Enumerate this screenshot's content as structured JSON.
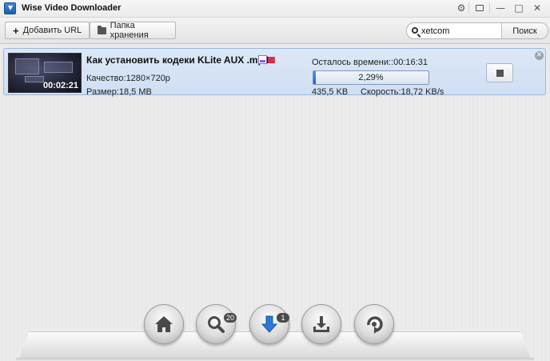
{
  "window": {
    "title": "Wise Video Downloader",
    "controls": {
      "settings_icon": "gear-icon",
      "menu_icon": "menu-icon",
      "minimize": "—",
      "maximize": "□",
      "close": "✕"
    }
  },
  "toolbar": {
    "add_url_label": "Добавить URL",
    "storage_folder_label": "Папка хранения",
    "search_value": "xetcom",
    "search_button_label": "Поиск"
  },
  "download": {
    "thumbnail_time": "00:02:21",
    "title": "Как установить кодеки KLite   AUX .mp4",
    "quality": "Качество:1280×720p",
    "size": "Размер:18,5 MB",
    "remaining": "Осталось времени::00:16:31",
    "progress_percent": 2.29,
    "progress_label": "2,29%",
    "downloaded": "435,5 KB",
    "speed": "Скорость:18,72 KB/s"
  },
  "dock": {
    "search_badge": "20",
    "download_badge": "1",
    "items": [
      "home-icon",
      "search-icon",
      "download-icon",
      "downloaded-icon",
      "convert-icon"
    ]
  },
  "colors": {
    "accent": "#1e63bc",
    "item_bg": "#d6e4f5"
  }
}
